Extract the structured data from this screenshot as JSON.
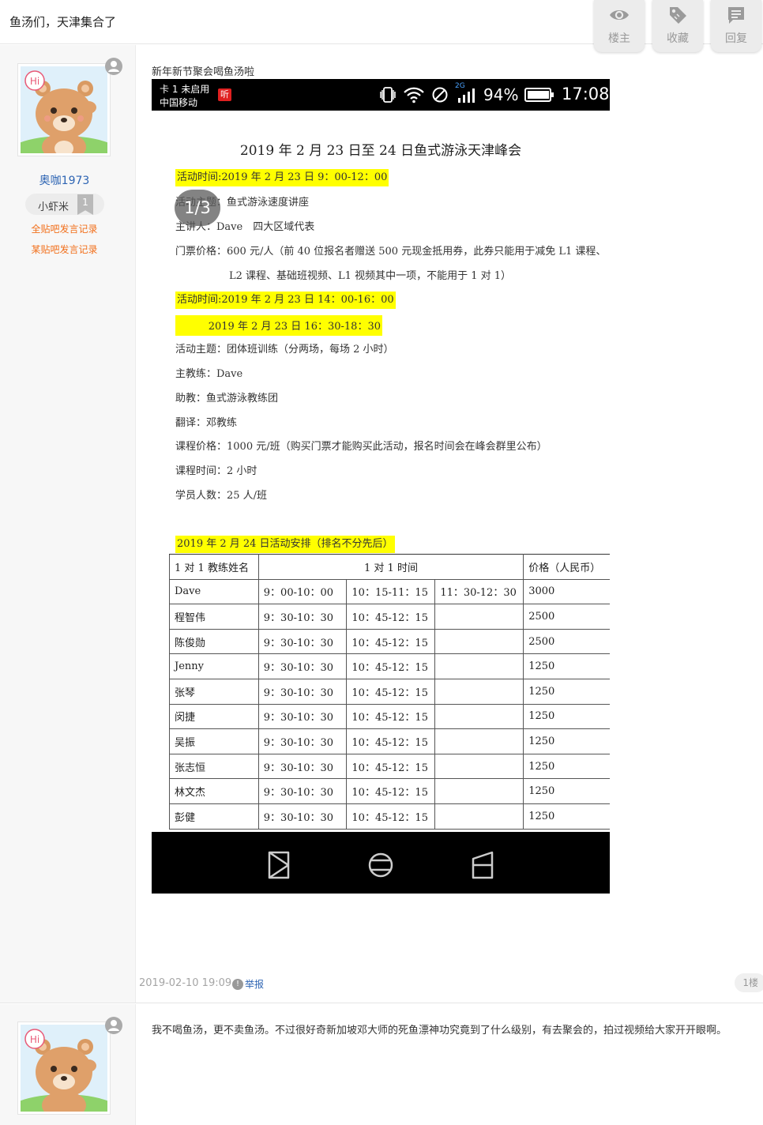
{
  "thread": {
    "title": "鱼汤们，天津集合了"
  },
  "toolbar": {
    "owner_label": "楼主",
    "favorite_label": "收藏",
    "reply_label": "回复"
  },
  "post1": {
    "username": "奥咖1973",
    "badge_name": "小虾米",
    "badge_level": "1",
    "record_all": "全贴吧发言记录",
    "record_this": "某贴吧发言记录",
    "text": "新年新节聚会喝鱼汤啦",
    "time": "2019-02-10 19:09",
    "report_label": "举报",
    "floor": "1楼",
    "screenshot": {
      "status": {
        "sim1": "卡 1 未启用",
        "sim2": "中国移动",
        "hd": "听",
        "net": "2G",
        "battery": "94%",
        "clock": "17:08"
      },
      "pager": "1/3",
      "doc_title": "2019 年 2 月 23 日至 24 日鱼式游泳天津峰会",
      "lines": [
        "活动时间:2019 年 2 月 23 日 9：00-12：00",
        "活动主题：鱼式游泳速度讲座",
        "主讲人：Dave　四大区域代表",
        "门票价格：600 元/人（前 40 位报名者赠送 500 元现金抵用券，此券只能用于减免 L1 课程、",
        "L2 课程、基础班视频、L1 视频其中一项，不能用于 1 对 1）",
        "活动时间:2019 年 2 月 23 日 14：00-16：00",
        "2019 年 2 月 23 日 16：30-18：30",
        "活动主题：团体班训练（分两场，每场 2 小时）",
        "主教练：Dave",
        "助教：鱼式游泳教练团",
        "翻译：邓教练",
        "课程价格：1000 元/班（购买门票才能购买此活动，报名时间会在峰会群里公布）",
        "课程时间：2 小时",
        "学员人数：25 人/班",
        "2019 年 2 月 24 日活动安排（排名不分先后）"
      ],
      "table": {
        "headers": [
          "1 对 1 教练姓名",
          "1 对 1 时间",
          "价格（人民币）"
        ],
        "rows": [
          [
            "Dave",
            "9：00-10：00",
            "10：15-11：15",
            "11：30-12：30",
            "3000"
          ],
          [
            "程智伟",
            "9：30-10：30",
            "10：45-12：15",
            "",
            "2500"
          ],
          [
            "陈俊勋",
            "9：30-10：30",
            "10：45-12：15",
            "",
            "2500"
          ],
          [
            "Jenny",
            "9：30-10：30",
            "10：45-12：15",
            "",
            "1250"
          ],
          [
            "张琴",
            "9：30-10：30",
            "10：45-12：15",
            "",
            "1250"
          ],
          [
            "闵捷",
            "9：30-10：30",
            "10：45-12：15",
            "",
            "1250"
          ],
          [
            "吴振",
            "9：30-10：30",
            "10：45-12：15",
            "",
            "1250"
          ],
          [
            "张志恒",
            "9：30-10：30",
            "10：45-12：15",
            "",
            "1250"
          ],
          [
            "林文杰",
            "9：30-10：30",
            "10：45-12：15",
            "",
            "1250"
          ],
          [
            "彭健",
            "9：30-10：30",
            "10：45-12：15",
            "",
            "1250"
          ]
        ]
      }
    }
  },
  "post2": {
    "text": "我不喝鱼汤，更不卖鱼汤。不过很好奇新加坡邓大师的死鱼漂神功究竟到了什么级别，有去聚会的，拍过视频给大家开开眼啊。"
  },
  "colors": {
    "username": "#2d64b3",
    "record_link": "#f2701c",
    "highlight": "#ffff00"
  }
}
